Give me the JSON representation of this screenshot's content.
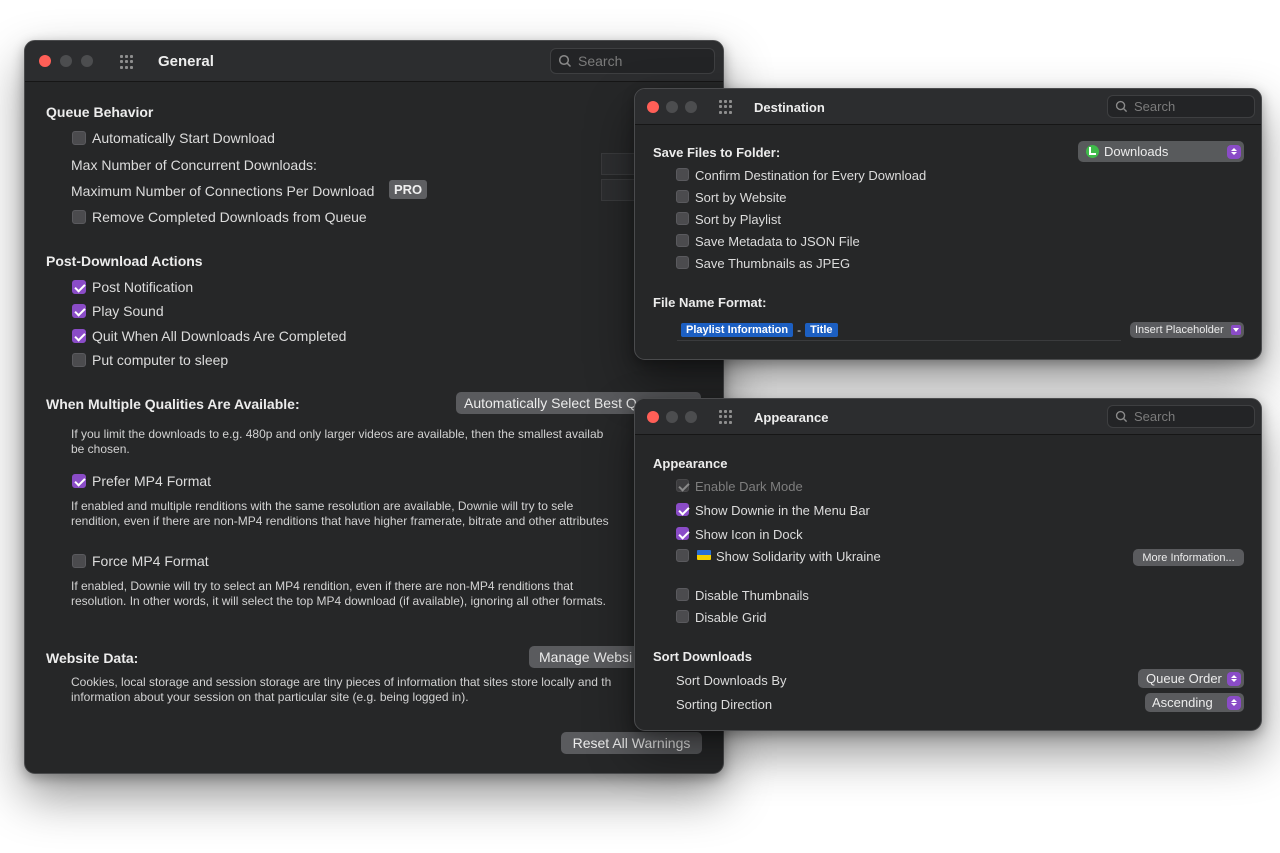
{
  "general": {
    "title": "General",
    "search_placeholder": "Search",
    "queue": {
      "heading": "Queue Behavior",
      "auto_start": "Automatically Start Download",
      "max_concurrent": "Max Number of Concurrent Downloads:",
      "max_connections": "Maximum Number of Connections Per Download",
      "pro_badge": "PRO",
      "remove_completed": "Remove Completed Downloads from Queue"
    },
    "post": {
      "heading": "Post-Download Actions",
      "notify": "Post Notification",
      "sound": "Play Sound",
      "quit": "Quit When All Downloads Are Completed",
      "sleep": "Put computer to sleep"
    },
    "qualities": {
      "heading": "When Multiple Qualities Are Available:",
      "popup": "Automatically Select Best Q",
      "desc1": "If you limit the downloads to e.g. 480p and only larger videos are available, then the smallest availab",
      "desc2": "be chosen.",
      "prefer_mp4": "Prefer MP4 Format",
      "prefer_desc1": "If enabled and multiple renditions with the same resolution are available, Downie will try to sele",
      "prefer_desc2": "rendition, even if there are non-MP4 renditions that have higher framerate, bitrate and other attributes",
      "force_mp4": "Force MP4 Format",
      "force_desc1": "If enabled, Downie will try to select an MP4 rendition, even if there are non-MP4 renditions that",
      "force_desc2": "resolution. In other words, it will select the top MP4 download (if available), ignoring all other formats."
    },
    "website": {
      "heading": "Website Data:",
      "button": "Manage Websi",
      "desc1": "Cookies, local storage and session storage are tiny pieces of information that sites store locally and th",
      "desc2": "information about your session on that particular site (e.g. being logged in)."
    },
    "reset_warnings": "Reset All Warnings"
  },
  "destination": {
    "title": "Destination",
    "search_placeholder": "Search",
    "save_label": "Save Files to Folder:",
    "folder": "Downloads",
    "options": [
      "Confirm Destination for Every Download",
      "Sort by Website",
      "Sort by Playlist",
      "Save Metadata to JSON File",
      "Save Thumbnails as JPEG"
    ],
    "format_label": "File Name Format:",
    "token1": "Playlist Information",
    "separator": "-",
    "token2": "Title",
    "insert_placeholder": "Insert Placeholder"
  },
  "appearance": {
    "title": "Appearance",
    "search_placeholder": "Search",
    "heading": "Appearance",
    "dark_mode": "Enable Dark Mode",
    "menu_bar": "Show Downie in the Menu Bar",
    "dock": "Show Icon in Dock",
    "solidarity": "Show Solidarity with Ukraine",
    "more_info": "More Information...",
    "disable_thumbnails": "Disable Thumbnails",
    "disable_grid": "Disable Grid",
    "sort_heading": "Sort Downloads",
    "sort_by_label": "Sort Downloads By",
    "sort_by_value": "Queue Order",
    "direction_label": "Sorting Direction",
    "direction_value": "Ascending"
  },
  "colors": {
    "accent": "#8a4cc7",
    "token": "#1c5fc2",
    "window": "#262728",
    "close": "#ff5f57"
  }
}
